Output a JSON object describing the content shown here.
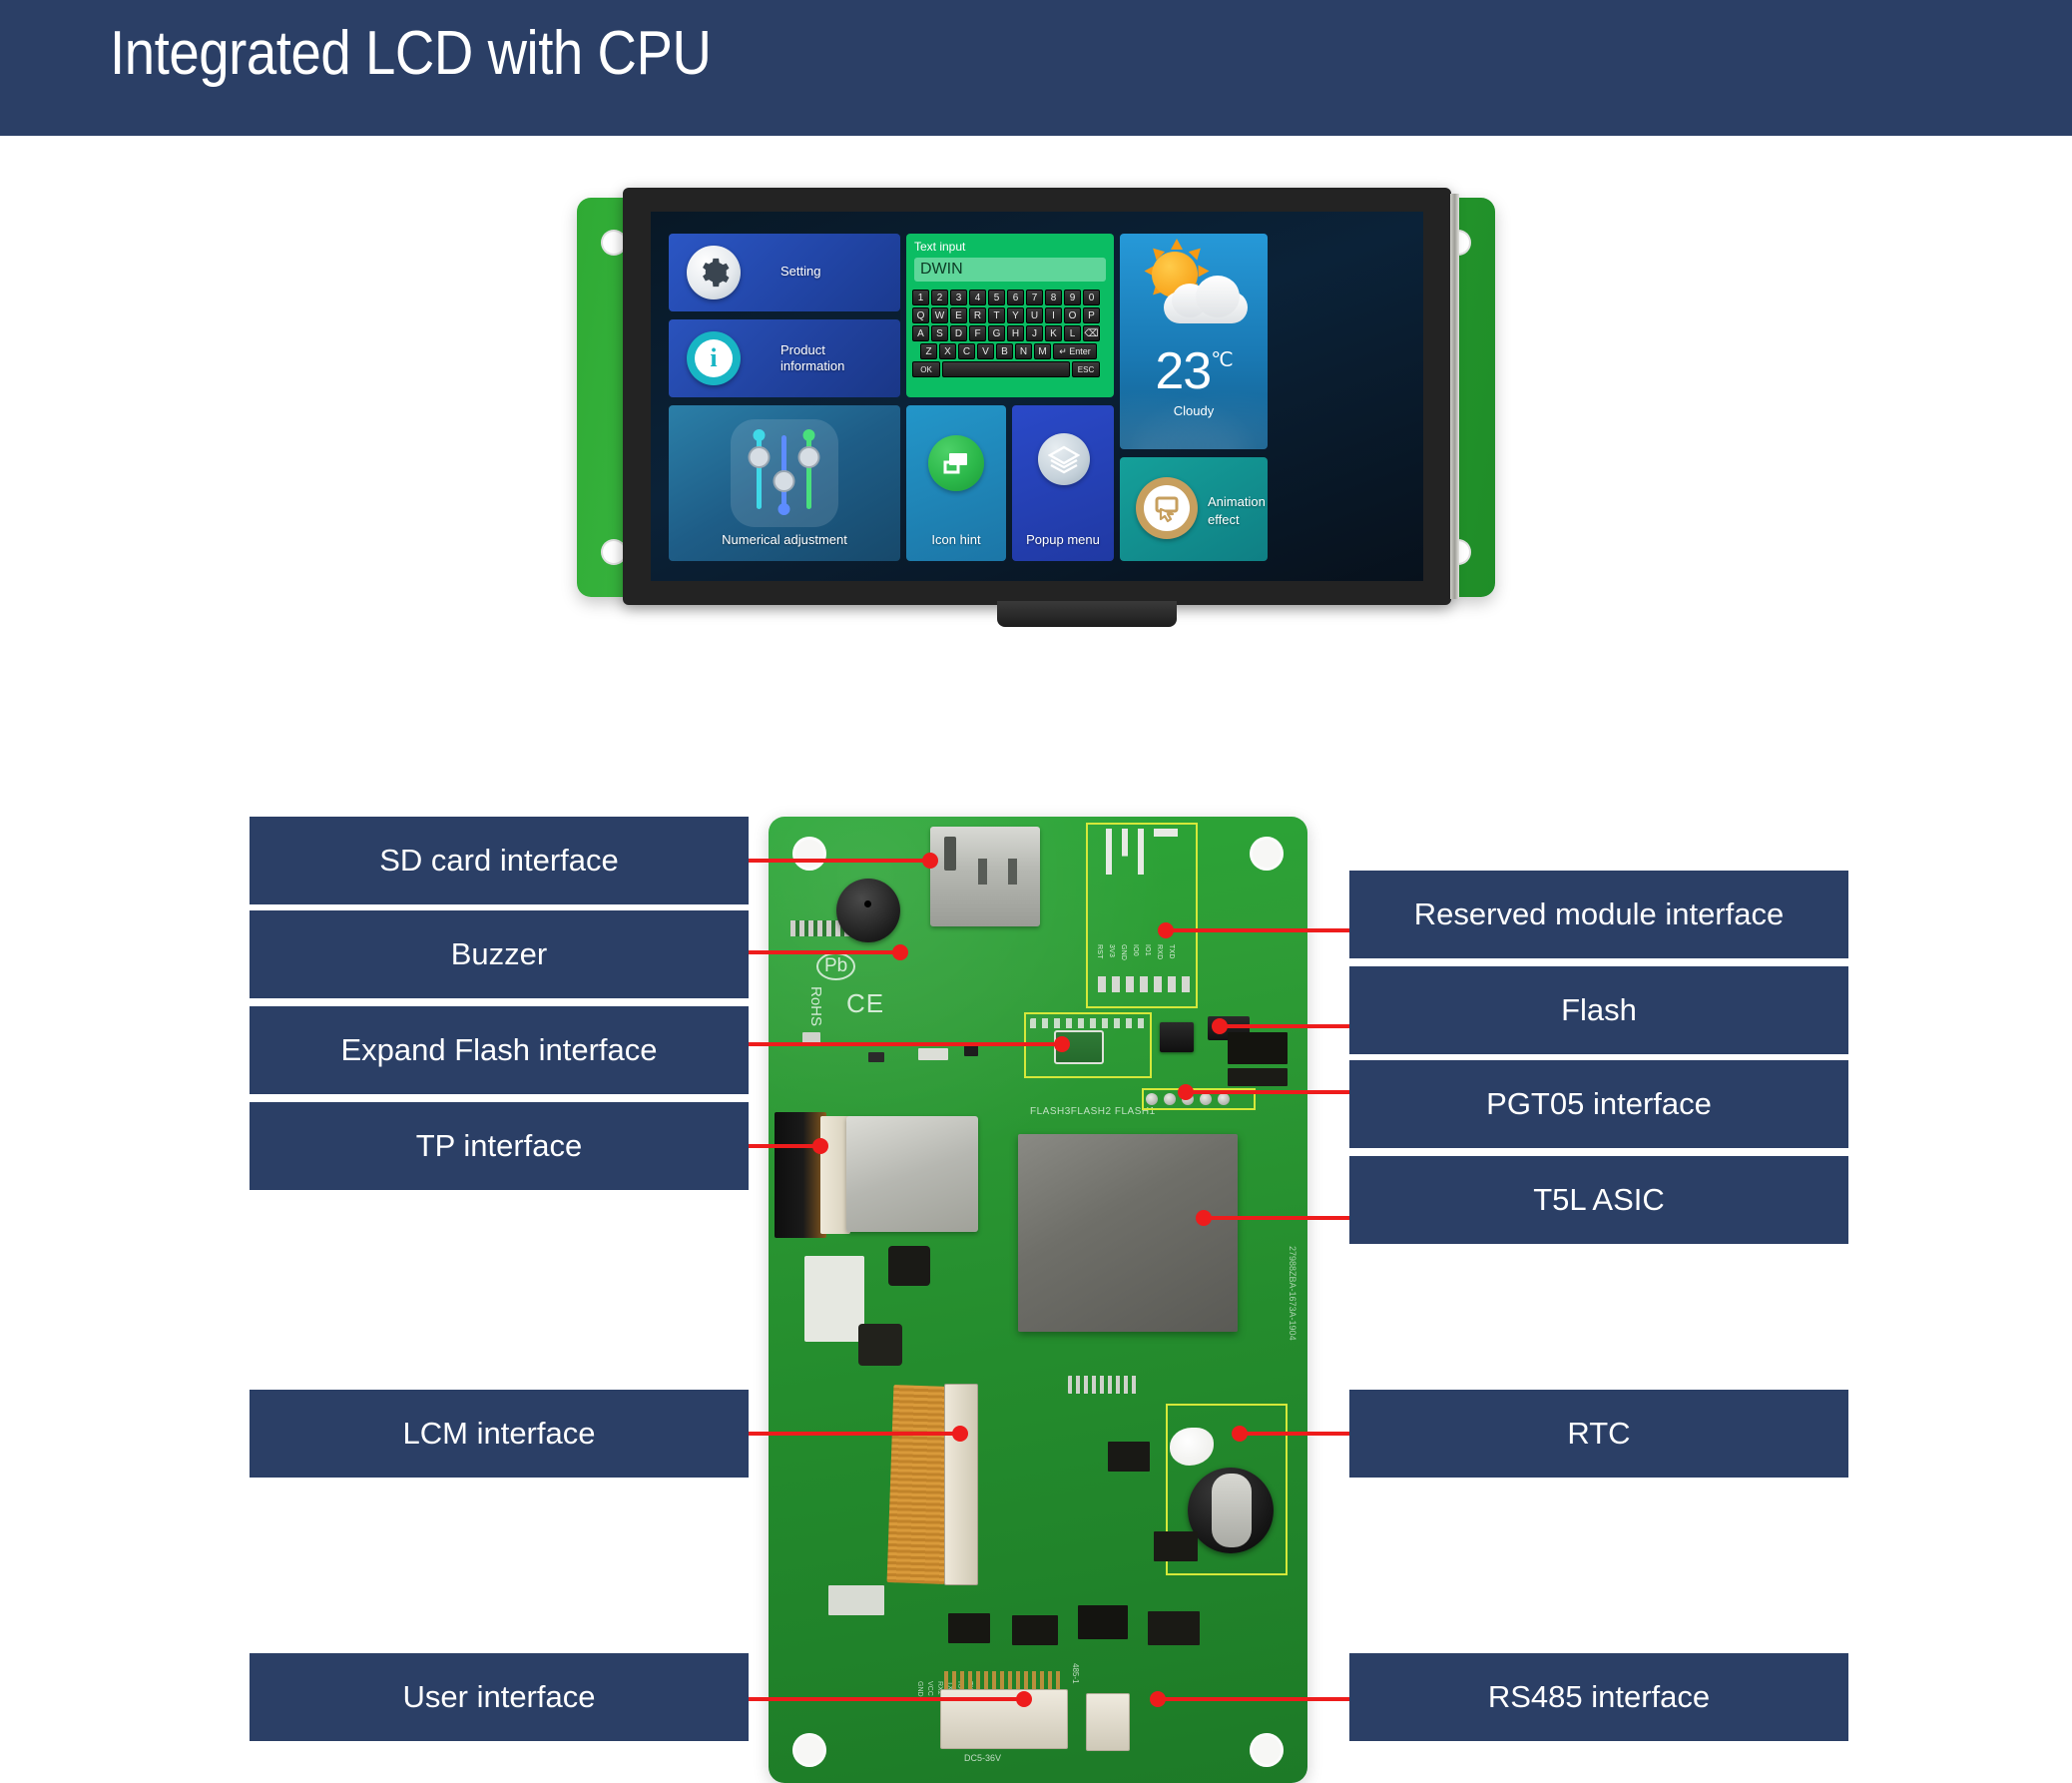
{
  "header": {
    "title": "Integrated LCD with CPU",
    "bg_color": "#2b3f66"
  },
  "lcd_demo_screen": {
    "tiles": [
      {
        "id": "setting",
        "label": "Setting",
        "icon": "gear-icon",
        "color": "#2246a8"
      },
      {
        "id": "product-information",
        "label": "Product\ninformation",
        "label_line1": "Product",
        "label_line2": "information",
        "icon": "info-icon",
        "color": "#21429f"
      },
      {
        "id": "numerical-adjustment",
        "label": "Numerical adjustment",
        "icon": "sliders-icon",
        "color": "#1e5d87"
      },
      {
        "id": "icon-hint",
        "label": "Icon hint",
        "icon": "window-icon",
        "color": "#1c76a7"
      },
      {
        "id": "popup-menu",
        "label": "Popup menu",
        "icon": "layers-icon",
        "color": "#2039a3"
      },
      {
        "id": "animation-effect",
        "label_line1": "Animation",
        "label_line2": "effect",
        "icon": "touch-icon",
        "color": "#0f7f84"
      }
    ],
    "keyboard": {
      "title": "Text input",
      "input_value": "DWIN",
      "row_numbers": [
        "1",
        "2",
        "3",
        "4",
        "5",
        "6",
        "7",
        "8",
        "9",
        "0"
      ],
      "row_q": [
        "Q",
        "W",
        "E",
        "R",
        "T",
        "Y",
        "U",
        "I",
        "O",
        "P"
      ],
      "row_a": [
        "A",
        "S",
        "D",
        "F",
        "G",
        "H",
        "J",
        "K",
        "L"
      ],
      "backspace_label": "⌫",
      "row_z": [
        "Z",
        "X",
        "C",
        "V",
        "B",
        "N",
        "M"
      ],
      "enter_label": "↵ Enter",
      "ok_label": "OK",
      "esc_label": "ESC",
      "space_label": ""
    },
    "weather": {
      "temperature": "23",
      "unit": "℃",
      "condition": "Cloudy",
      "icon": "sun-behind-cloud-icon"
    }
  },
  "board_callouts": {
    "left": [
      {
        "id": "sd-card-interface",
        "label": "SD card interface"
      },
      {
        "id": "buzzer",
        "label": "Buzzer"
      },
      {
        "id": "expand-flash-interface",
        "label": "Expand Flash interface"
      },
      {
        "id": "tp-interface",
        "label": "TP interface"
      },
      {
        "id": "lcm-interface",
        "label": "LCM interface"
      },
      {
        "id": "user-interface",
        "label": "User interface"
      }
    ],
    "right": [
      {
        "id": "reserved-module-interface",
        "label": "Reserved module interface"
      },
      {
        "id": "flash",
        "label": "Flash"
      },
      {
        "id": "pgt05-interface",
        "label": "PGT05 interface"
      },
      {
        "id": "t5l-asic",
        "label": "T5L ASIC"
      },
      {
        "id": "rtc",
        "label": "RTC"
      },
      {
        "id": "rs485-interface",
        "label": "RS485 interface"
      }
    ],
    "box_color": "#2b3f66",
    "leader_color": "#ee1c1c",
    "highlight_color": "#d5e83a"
  },
  "board_silkscreen": {
    "pb": "Pb",
    "ce": "CE",
    "rohs": "RoHS",
    "flash_marks": "FLASH3FLASH2 FLASH1",
    "dc_mark": "DC5-36V",
    "rs485_mark": "485-1",
    "module_pins": [
      "RST",
      "3V3",
      "GND",
      "IO0",
      "IO1",
      "RXD",
      "TXD"
    ],
    "serial_number": "27988ZBA-1673A-1904"
  }
}
